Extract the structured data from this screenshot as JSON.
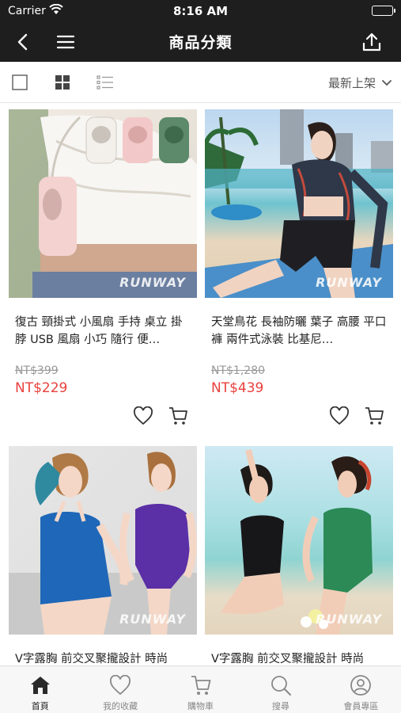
{
  "status_bar": {
    "carrier": "Carrier",
    "time": "8:16 AM"
  },
  "nav": {
    "title": "商品分類"
  },
  "toolbar": {
    "sort_label": "最新上架"
  },
  "products": [
    {
      "name": "復古 頸掛式 小風扇 手持 桌立 掛脖 USB 風扇 小巧 隨行 便…",
      "price_old": "NT$399",
      "price_new": "NT$229",
      "watermark": "RUNWAY"
    },
    {
      "name": "天堂鳥花 長袖防曬 葉子 高腰 平口褲 兩件式泳裝 比基尼…",
      "price_old": "NT$1,280",
      "price_new": "NT$439",
      "watermark": "RUNWAY"
    },
    {
      "name": "V字露胸 前交叉聚攏設計 時尚",
      "watermark": "RUNWAY"
    },
    {
      "name": "V字露胸 前交叉聚攏設計 時尚",
      "watermark": "RUNWAY"
    }
  ],
  "tabs": [
    {
      "label": "首頁",
      "icon": "home-icon",
      "active": true
    },
    {
      "label": "我的收藏",
      "icon": "heart-icon"
    },
    {
      "label": "購物車",
      "icon": "cart-icon"
    },
    {
      "label": "搜尋",
      "icon": "search-icon"
    },
    {
      "label": "會員專區",
      "icon": "user-icon"
    }
  ]
}
